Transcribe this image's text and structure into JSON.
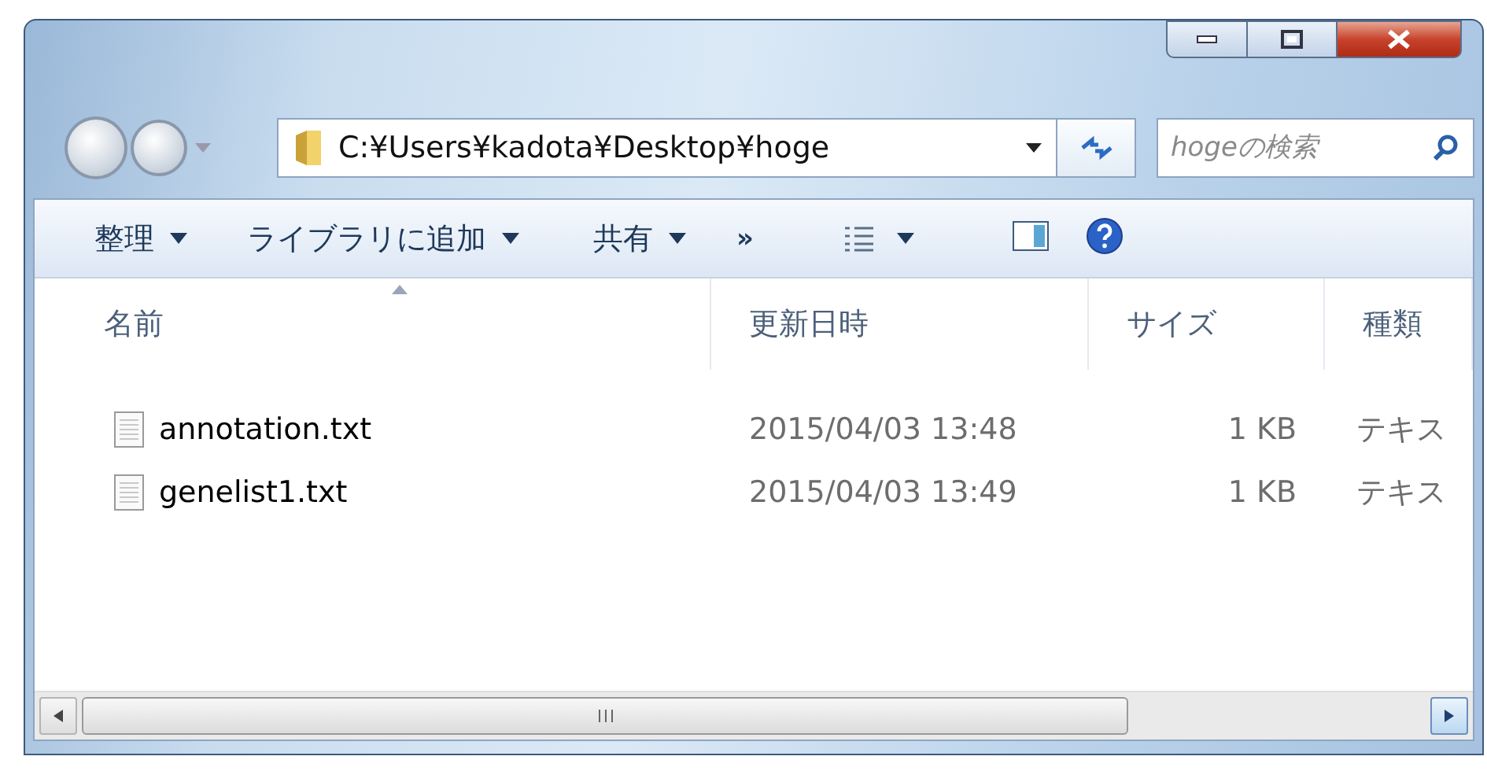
{
  "address_bar": {
    "path": "C:¥Users¥kadota¥Desktop¥hoge"
  },
  "search": {
    "placeholder": "hogeの検索"
  },
  "toolbar": [
    {
      "kind": "menu",
      "label": "整理"
    },
    {
      "kind": "menu",
      "label": "ライブラリに追加"
    },
    {
      "kind": "menu",
      "label": "共有"
    },
    {
      "kind": "overflow",
      "label": "»"
    },
    {
      "kind": "views"
    },
    {
      "kind": "preview"
    },
    {
      "kind": "help"
    }
  ],
  "columns": [
    {
      "label": "名前",
      "sorted": true
    },
    {
      "label": "更新日時",
      "sorted": false
    },
    {
      "label": "サイズ",
      "sorted": false
    },
    {
      "label": "種類",
      "sorted": false
    }
  ],
  "files": [
    {
      "name": "annotation.txt",
      "modified": "2015/04/03 13:48",
      "size": "1 KB",
      "type": "テキス"
    },
    {
      "name": "genelist1.txt",
      "modified": "2015/04/03 13:49",
      "size": "1 KB",
      "type": "テキス"
    }
  ]
}
